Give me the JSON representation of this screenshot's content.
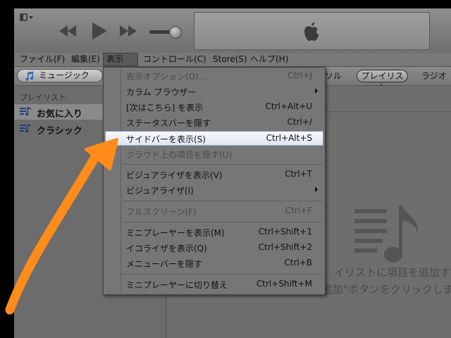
{
  "menubar": {
    "file": "ファイル(F)",
    "edit": "編集(E)",
    "view": "表示(V)",
    "controls": "コントロール(C)",
    "store": "Store(S)",
    "help": "ヘルプ(H)"
  },
  "toolbar": {
    "source": "ミュージック",
    "tab_partial": "ソル",
    "playlist": "プレイリスト",
    "radio": "ラジオ"
  },
  "sidebar": {
    "heading": "プレイリスト",
    "items": [
      {
        "label": "お気に入り",
        "selected": true
      },
      {
        "label": "クラシック",
        "selected": false
      }
    ]
  },
  "main": {
    "empty_line1": "イリストに項目を追加す",
    "empty_line2": "追加\"ボタンをクリックしま"
  },
  "view_menu": {
    "items": [
      {
        "label": "表示オプション(O)...",
        "shortcut": "Ctrl+J",
        "disabled": true
      },
      {
        "label": "カラム ブラウザー",
        "submenu": true
      },
      {
        "label": "[次はこちら] を表示",
        "shortcut": "Ctrl+Alt+U"
      },
      {
        "label": "ステータスバーを隠す",
        "shortcut": "Ctrl+/"
      },
      {
        "label": "サイドバーを表示(S)",
        "shortcut": "Ctrl+Alt+S",
        "highlighted": true
      },
      {
        "label": "クラウド上の項目を隠す(U)",
        "disabled": true
      },
      {
        "label": "ビジュアライザを表示(V)",
        "shortcut": "Ctrl+T"
      },
      {
        "label": "ビジュアライザ(I)",
        "submenu": true
      },
      {
        "label": "フルスクリーン(F)",
        "shortcut": "Ctrl+F",
        "disabled": true
      },
      {
        "label": "ミニプレーヤーを表示(M)",
        "shortcut": "Ctrl+Shift+1"
      },
      {
        "label": "イコライザを表示(Q)",
        "shortcut": "Ctrl+Shift+2"
      },
      {
        "label": "メニューバーを隠す",
        "shortcut": "Ctrl+B"
      },
      {
        "label": "ミニプレーヤーに切り替え",
        "shortcut": "Ctrl+Shift+M"
      }
    ]
  },
  "colors": {
    "annotation_arrow": "#ff8c1a",
    "highlight_border": "#8aa0bf"
  }
}
